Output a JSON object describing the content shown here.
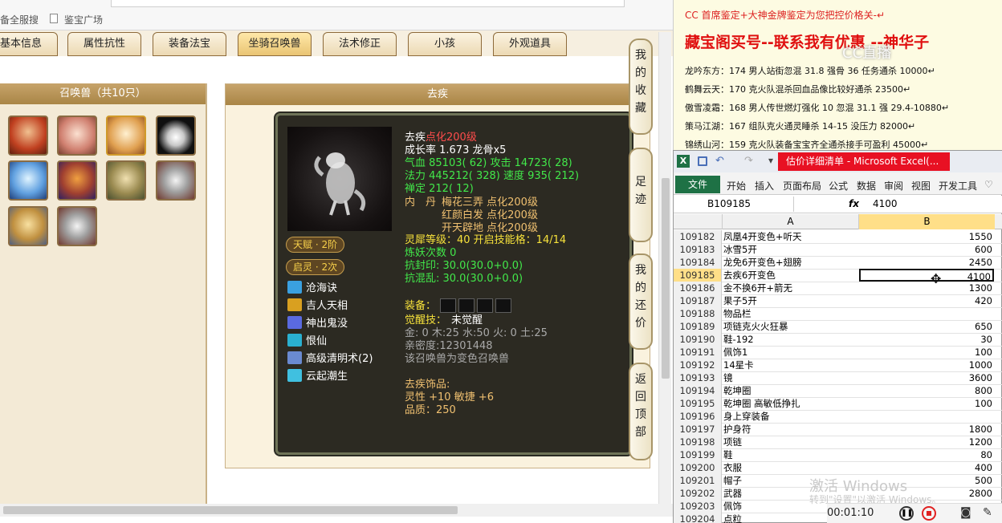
{
  "browser": {
    "bookmarks": [
      "备全服搜",
      "鉴宝广场"
    ],
    "tabs": [
      "基本信息",
      "属性抗性",
      "装备法宝",
      "坐骑召唤兽",
      "法术修正",
      "小孩",
      "外观道具"
    ],
    "active_tab": "坐骑召唤兽"
  },
  "summons_panel": {
    "title": "召唤兽（共10只）",
    "pets": [
      "pet-1",
      "pet-2",
      "pet-3",
      "pet-4",
      "pet-5",
      "pet-6",
      "pet-7",
      "pet-8",
      "pet-9",
      "pet-10"
    ]
  },
  "pet_detail": {
    "panel_title": "去疾",
    "name": "去疾",
    "name_suffix": "点化200级",
    "growth": "成长率 1.673 龙骨x5",
    "stats_1": "气血 85103( 62) 攻击 14723( 28)",
    "stats_2": "法力 445212( 328) 速度 935( 212)",
    "stats_3": "禅定 212( 12)",
    "inner_label": "内　丹",
    "inner_1": "梅花三弄 点化200级",
    "inner_2": "红颜白发 点化200级",
    "inner_3": "开天辟地 点化200级",
    "lingxi": "灵犀等级：40 开启技能格：14/14",
    "lianyao": "炼妖次数 0",
    "kangfeng": "抗封印: 30.0(30.0+0.0)",
    "kanghun": "抗混乱: 30.0(30.0+0.0)",
    "equip_label": "装备：",
    "awaken_label": "觉醒技：",
    "awaken_value": "未觉醒",
    "elements": "金: 0 木:25 水:50 火: 0 土:25",
    "intimacy": "亲密度:12301448",
    "note": "该召唤兽为变色召唤兽",
    "accessory_label": "去疾饰品:",
    "accessory_stats": "灵性 +10 敏捷 +6",
    "accessory_quality": "品质：250",
    "tianfu": "天赋 · 2阶",
    "qiling": "启灵 · 2次",
    "skills": [
      "沧海诀",
      "吉人天相",
      "神出鬼没",
      "恨仙",
      "高级清明术(2)",
      "云起潮生"
    ],
    "skill_colors": [
      "#3aa0e0",
      "#d9a020",
      "#5a6ae0",
      "#2ab0d0",
      "#6a8ad0",
      "#40c0e0"
    ]
  },
  "side_buttons": [
    "我的收藏",
    "足迹",
    "我的还价",
    "返回顶部"
  ],
  "doc": {
    "line1": "CC 首席鉴定+大神金牌鉴定为您把控价格关-↵",
    "line2": "藏宝阁买号--联系我有优惠 --神华子",
    "rows": [
      "龙吟东方：174 男人站街忽混 31.8 强骨 36 任务通杀 10000↵",
      "鹤舞云天：170 克火队混杀回血品像比较好通杀 23500↵",
      "傲雪凌霜：168 男人传世燃灯强化 10 忽混 31.1 强 29.4-10880↵",
      "策马江湖：167 组队克火通灵睡杀 14-15 没压力 82000↵",
      "锦绣山河：159 克火队装备宝宝齐全通杀接手可盈利 45000↵"
    ],
    "logo": "CC直播"
  },
  "excel": {
    "title": "估价详细清单 - Microsoft Excel(...",
    "ribbon": [
      "开始",
      "插入",
      "页面布局",
      "公式",
      "数据",
      "审阅",
      "视图",
      "开发工具"
    ],
    "file_label": "文件",
    "cell_ref": "B109185",
    "fx": "fx",
    "formula": "4100",
    "col_a": "A",
    "col_b": "B",
    "rows": [
      [
        "109182",
        "凤凰4开变色+听天",
        "1550"
      ],
      [
        "109183",
        "冰雪5开",
        "600"
      ],
      [
        "109184",
        "龙免6开变色+翅膀",
        "2450"
      ],
      [
        "109185",
        "去疾6开变色",
        "4100"
      ],
      [
        "109186",
        "金不换6开+箭无",
        "1300"
      ],
      [
        "109187",
        "果子5开",
        "420"
      ],
      [
        "109188",
        "物品栏",
        ""
      ],
      [
        "109189",
        "项链克火火狂暴",
        "650"
      ],
      [
        "109190",
        "鞋-192",
        "30"
      ],
      [
        "109191",
        "佩饰1",
        "100"
      ],
      [
        "109192",
        "14星卡",
        "1000"
      ],
      [
        "109193",
        "镜",
        "3600"
      ],
      [
        "109194",
        "乾坤圈",
        "800"
      ],
      [
        "109195",
        "乾坤圈 高敏低挣扎",
        "100"
      ],
      [
        "109196",
        "身上穿装备",
        ""
      ],
      [
        "109197",
        "护身符",
        "1800"
      ],
      [
        "109198",
        "项链",
        "1200"
      ],
      [
        "109199",
        "鞋",
        "80"
      ],
      [
        "109200",
        "衣服",
        "400"
      ],
      [
        "109201",
        "帽子",
        "500"
      ],
      [
        "109202",
        "武器",
        "2800"
      ],
      [
        "109203",
        "佩饰",
        ""
      ],
      [
        "109204",
        "点粒",
        ""
      ]
    ],
    "selected_row": "109185"
  },
  "watermark": {
    "line1": "激活 Windows",
    "line2": "转到\"设置\"以激活 Windows。"
  },
  "recorder": {
    "time": "00:01:10"
  }
}
